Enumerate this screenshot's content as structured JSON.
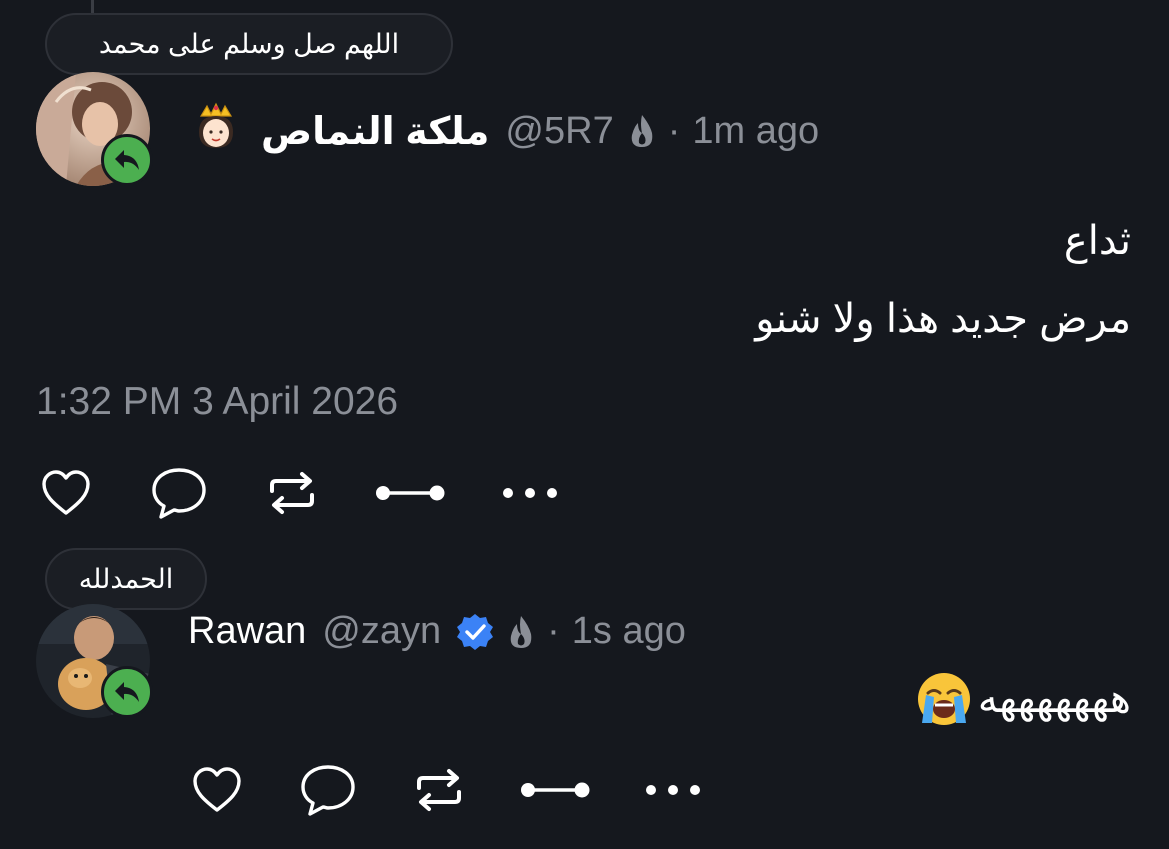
{
  "post1": {
    "status_bubble": "اللهم صل وسلم على محمد",
    "author_name": "ملكة النماص",
    "author_emoji": "crown-princess-emoji",
    "handle": "@5R7",
    "separator": "·",
    "time_ago": "1m ago",
    "text_lines": [
      "ثداع",
      "مرض جديد هذا ولا شنو"
    ],
    "timestamp": "1:32 PM 3 April 2026"
  },
  "post2": {
    "status_bubble": "الحمدلله",
    "author_name": "Rawan",
    "handle": "@zayn",
    "separator": "·",
    "time_ago": "1s ago",
    "text": "هههههههه",
    "text_emoji": "loudly-crying-face-emoji"
  },
  "actions": [
    "like-icon",
    "reply-icon",
    "repost-icon",
    "link-icon",
    "more-icon"
  ],
  "colors": {
    "background": "#15181e",
    "text": "#ffffff",
    "muted": "#8b8f97",
    "reply_badge": "#4caf50",
    "verified": "#3b82f6"
  }
}
